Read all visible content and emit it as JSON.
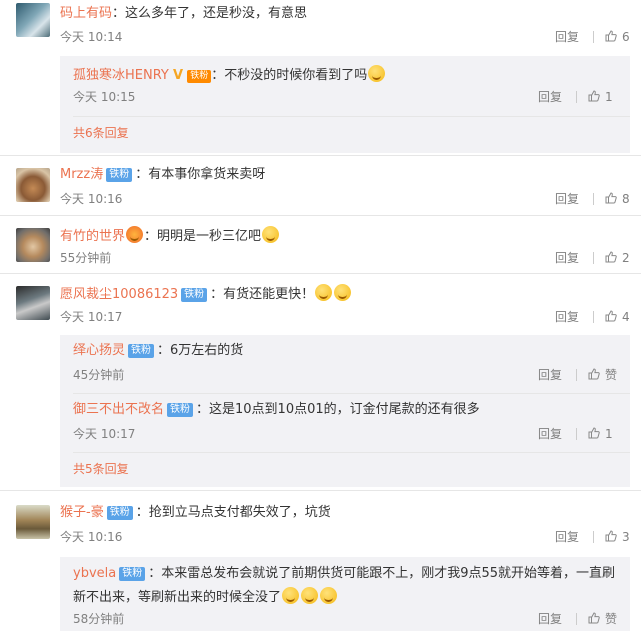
{
  "reply_label": "回复",
  "comments": [
    {
      "user": "码上有码",
      "text": "：这么多年了，还是秒没，有意思",
      "time": "今天 10:14",
      "likes": "6",
      "replies": [
        {
          "user": "孤独寒冰HENRY",
          "vip": "V",
          "medal": "铁粉",
          "text": "：不秒没的时候你看到了吗",
          "time": "今天 10:15",
          "likes": "1"
        }
      ],
      "more": "共6条回复"
    },
    {
      "user": "Mrzz涛",
      "badge": "铁粉",
      "text": "：有本事你拿货来卖呀",
      "time": "今天 10:16",
      "likes": "8"
    },
    {
      "user": "有竹的世界",
      "text": "：明明是一秒三亿吧",
      "time": "55分钟前",
      "likes": "2"
    },
    {
      "user": "愿风裁尘10086123",
      "badge": "铁粉",
      "text": "：有货还能更快！",
      "time": "今天 10:17",
      "likes": "4",
      "replies": [
        {
          "user": "绎心扬灵",
          "badge": "铁粉",
          "text": "：6万左右的货",
          "time": "45分钟前",
          "likes": "赞"
        },
        {
          "user": "御三不出不改名",
          "badge": "铁粉",
          "text": "：这是10点到10点01的，订金付尾款的还有很多",
          "time": "今天 10:17",
          "likes": "1"
        }
      ],
      "more": "共5条回复"
    },
    {
      "user": "猴子-豪",
      "badge": "铁粉",
      "text": "：抢到立马点支付都失效了，坑货",
      "time": "今天 10:16",
      "likes": "3",
      "replies": [
        {
          "user": "ybvela",
          "badge": "铁粉",
          "text1": "：本来雷总发布会就说了前期供货可能跟不上，刚才我9点55就开始等着，一直刷",
          "text2": "新不出来，等刷新出来的时候全没了",
          "time": "58分钟前",
          "likes": "赞"
        }
      ]
    }
  ]
}
